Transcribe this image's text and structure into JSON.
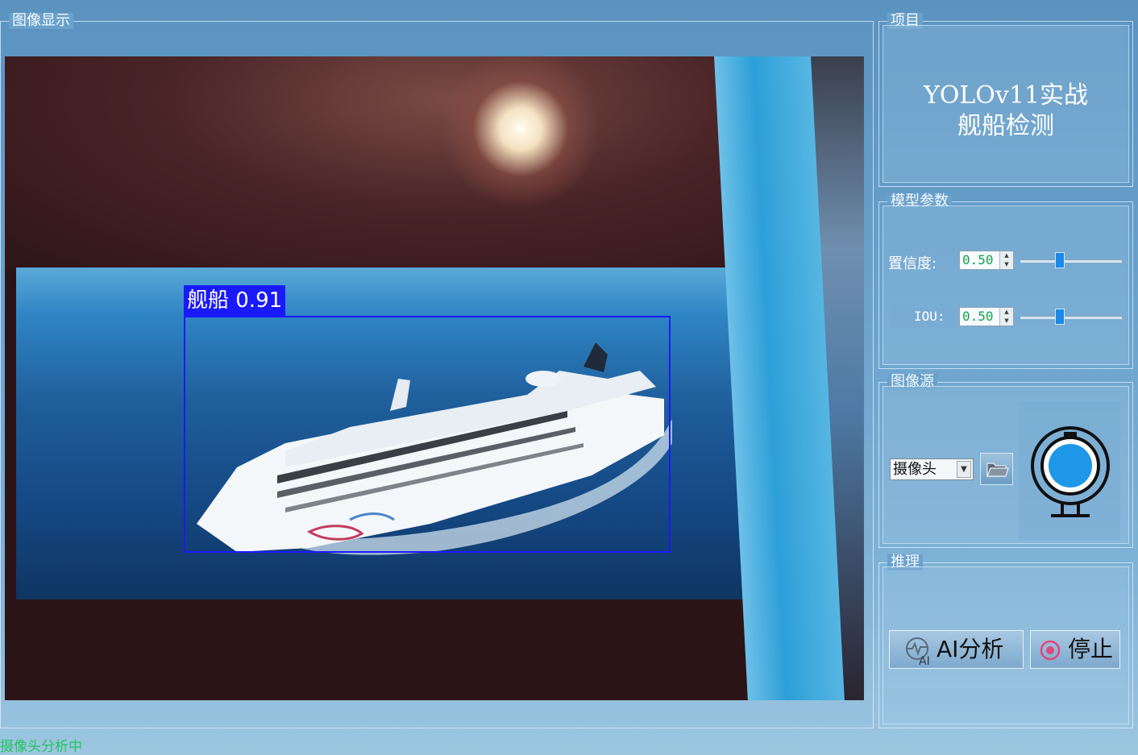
{
  "display_group": {
    "title": "图像显示"
  },
  "detection": {
    "label": "舰船 0.91",
    "class_name": "舰船",
    "confidence": 0.91,
    "box_color": "#1a1aff"
  },
  "project_group": {
    "title": "项目",
    "line1": "YOLOv11实战",
    "line2": "舰船检测"
  },
  "params_group": {
    "title": "模型参数",
    "confidence": {
      "label": "置信度:",
      "value": "0.50",
      "slider_fraction": 0.38
    },
    "iou": {
      "label": "IOU:",
      "value": "0.50",
      "slider_fraction": 0.38
    }
  },
  "source_group": {
    "title": "图像源",
    "selected": "摄像头"
  },
  "inference_group": {
    "title": "推理",
    "analyze_label": "AI分析",
    "stop_label": "停止"
  },
  "status": {
    "text": "摄像头分析中"
  },
  "colors": {
    "accent": "#1e88e5",
    "status": "#22c55e",
    "stop_icon": "#e0457b"
  }
}
